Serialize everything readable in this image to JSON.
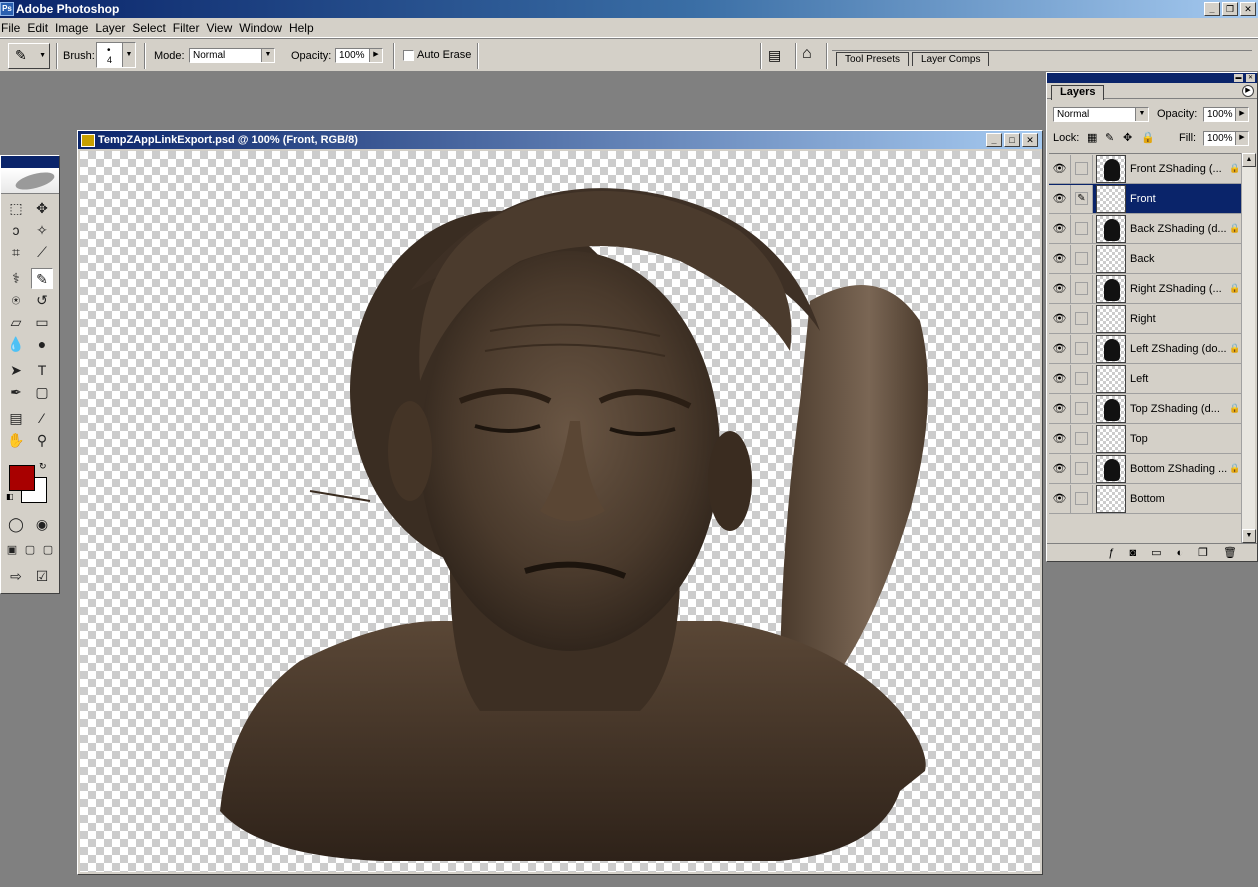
{
  "app": {
    "title": "Adobe Photoshop"
  },
  "menu": [
    "File",
    "Edit",
    "Image",
    "Layer",
    "Select",
    "Filter",
    "View",
    "Window",
    "Help"
  ],
  "options": {
    "brush_label": "Brush:",
    "brush_size": "4",
    "mode_label": "Mode:",
    "mode_value": "Normal",
    "opacity_label": "Opacity:",
    "opacity_value": "100%",
    "auto_erase_label": "Auto Erase",
    "auto_erase_checked": false
  },
  "palette_well": {
    "tabs": [
      "Tool Presets",
      "Layer Comps"
    ]
  },
  "colors": {
    "foreground": "#a80000",
    "background": "#ffffff",
    "title_bar": "#0a246a",
    "sculpt": "#4a3a2c"
  },
  "document": {
    "title": "TempZAppLinkExport.psd @ 100% (Front, RGB/8)"
  },
  "layers_panel": {
    "tab": "Layers",
    "blend_mode": "Normal",
    "opacity_label": "Opacity:",
    "opacity_value": "100%",
    "lock_label": "Lock:",
    "fill_label": "Fill:",
    "fill_value": "100%",
    "selected": "Front",
    "layers": [
      {
        "name": "Front ZShading (...",
        "has_mask": true,
        "locked": true
      },
      {
        "name": "Front",
        "has_mask": false,
        "locked": false
      },
      {
        "name": "Back ZShading (d...",
        "has_mask": true,
        "locked": true
      },
      {
        "name": "Back",
        "has_mask": false,
        "locked": false
      },
      {
        "name": "Right ZShading (...",
        "has_mask": true,
        "locked": true
      },
      {
        "name": "Right",
        "has_mask": false,
        "locked": false
      },
      {
        "name": "Left ZShading (do...",
        "has_mask": true,
        "locked": true
      },
      {
        "name": "Left",
        "has_mask": false,
        "locked": false
      },
      {
        "name": "Top ZShading (d...",
        "has_mask": true,
        "locked": true
      },
      {
        "name": "Top",
        "has_mask": false,
        "locked": false
      },
      {
        "name": "Bottom ZShading ...",
        "has_mask": true,
        "locked": true
      },
      {
        "name": "Bottom",
        "has_mask": false,
        "locked": false
      }
    ]
  }
}
